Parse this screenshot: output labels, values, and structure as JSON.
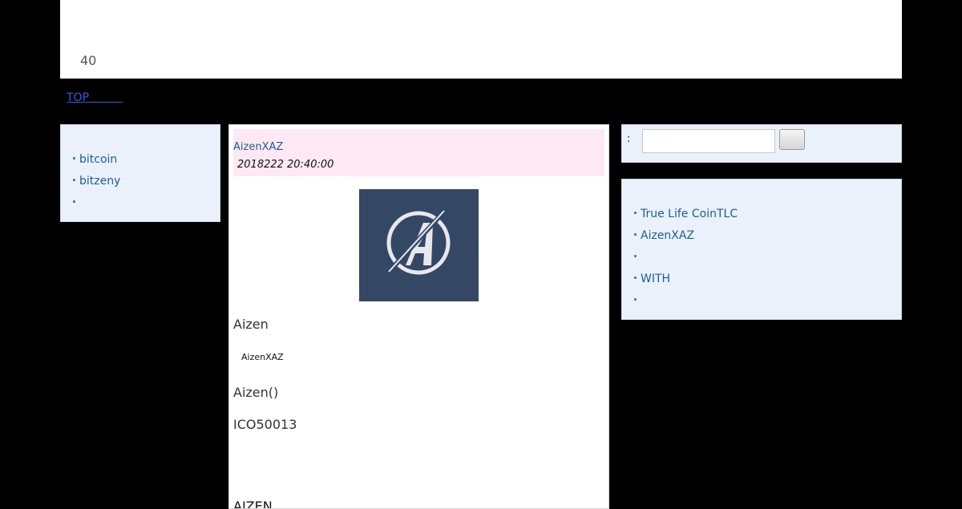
{
  "header": {
    "count": "40"
  },
  "nav": {
    "top_link": "TOP　　　"
  },
  "left_sidebar": {
    "items": [
      {
        "label": "bitcoin"
      },
      {
        "label": "bitzeny"
      },
      {
        "label": ""
      }
    ]
  },
  "search": {
    "label": ":",
    "value": "",
    "button_label": ""
  },
  "right_sidebar": {
    "items": [
      {
        "label": "True Life CoinTLC"
      },
      {
        "label": "AizenXAZ"
      },
      {
        "label": ""
      },
      {
        "label": "WITH"
      },
      {
        "label": ""
      }
    ]
  },
  "article": {
    "title": "AizenXAZ",
    "date": "2018222 20:40:00",
    "image_icon": "aizen-logo-icon",
    "paragraphs": [
      "Aizen",
      "AizenXAZ",
      "Aizen()",
      "ICO50013",
      "AIZEN"
    ]
  },
  "colors": {
    "background": "#000000",
    "panel_bg": "#eaf1fb",
    "article_head_bg": "#fde8f3",
    "link": "#1a5f95",
    "logo_bg": "#344866"
  }
}
